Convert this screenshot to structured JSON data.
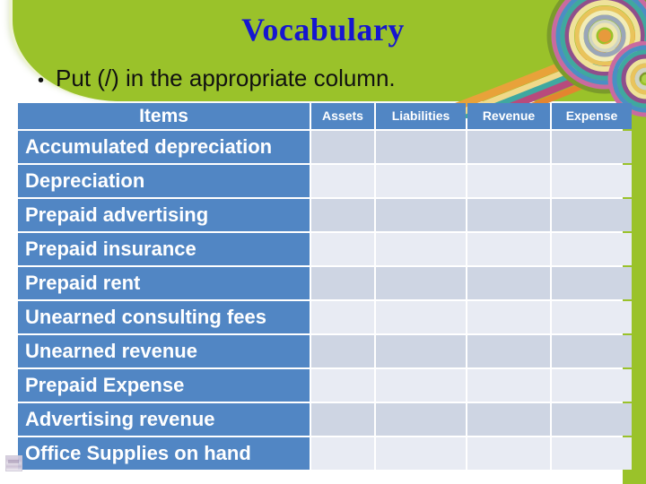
{
  "slide": {
    "title": "Vocabulary",
    "instruction": {
      "bullet_glyph": "•",
      "text": "Put (/) in the appropriate column."
    },
    "colors": {
      "background": "#ffffff",
      "accent_green": "#9ac22a",
      "title_blue": "#1616cf",
      "table_header_blue": "#5186c4",
      "cell_dark": "#ced5e3",
      "cell_light": "#e8ebf3"
    }
  },
  "table": {
    "columns": [
      "Items",
      "Assets",
      "Liabilities",
      "Revenue",
      "Expense"
    ],
    "rows": [
      {
        "item": "Accumulated depreciation",
        "assets": "",
        "liabilities": "",
        "revenue": "",
        "expense": ""
      },
      {
        "item": "Depreciation",
        "assets": "",
        "liabilities": "",
        "revenue": "",
        "expense": ""
      },
      {
        "item": "Prepaid advertising",
        "assets": "",
        "liabilities": "",
        "revenue": "",
        "expense": ""
      },
      {
        "item": "Prepaid insurance",
        "assets": "",
        "liabilities": "",
        "revenue": "",
        "expense": ""
      },
      {
        "item": "Prepaid rent",
        "assets": "",
        "liabilities": "",
        "revenue": "",
        "expense": ""
      },
      {
        "item": "Unearned consulting fees",
        "assets": "",
        "liabilities": "",
        "revenue": "",
        "expense": ""
      },
      {
        "item": "Unearned revenue",
        "assets": "",
        "liabilities": "",
        "revenue": "",
        "expense": ""
      },
      {
        "item": "Prepaid Expense",
        "assets": "",
        "liabilities": "",
        "revenue": "",
        "expense": ""
      },
      {
        "item": "Advertising revenue",
        "assets": "",
        "liabilities": "",
        "revenue": "",
        "expense": ""
      },
      {
        "item": "Office Supplies on hand",
        "assets": "",
        "liabilities": "",
        "revenue": "",
        "expense": ""
      }
    ]
  },
  "decorations": {
    "rings_icon": "concentric-rings-decoration",
    "swoosh_icon": "rainbow-swoosh-decoration",
    "thumbnail_icon": "image-thumbnail"
  }
}
